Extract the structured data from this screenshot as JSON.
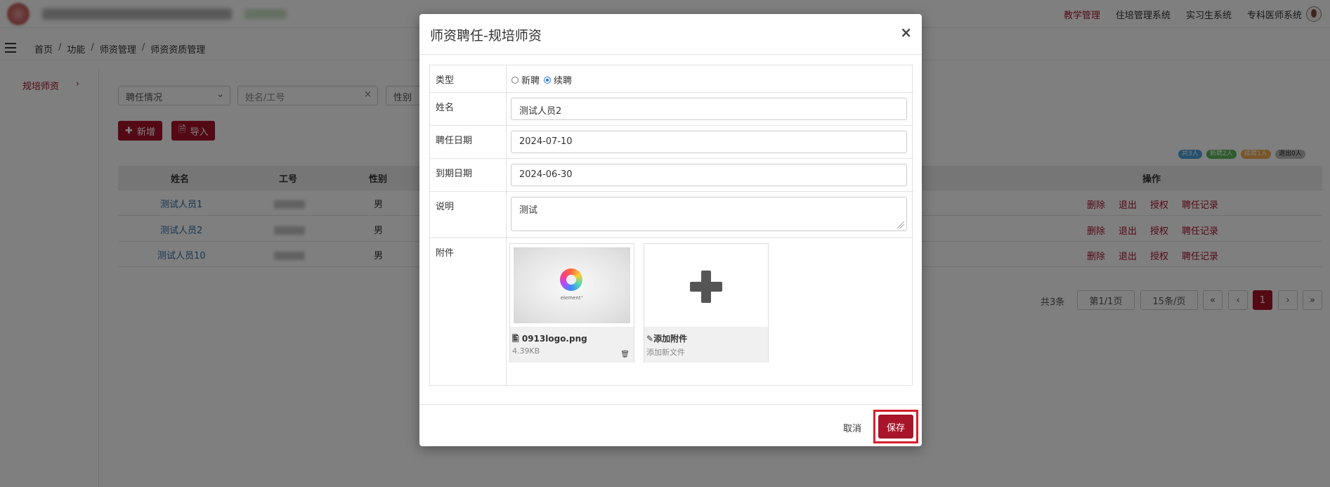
{
  "topbar": {
    "nav": [
      "教学管理",
      "住培管理系统",
      "实习生系统",
      "专科医师系统"
    ],
    "active_nav": "教学管理"
  },
  "breadcrumb": [
    "首页",
    "功能",
    "师资管理",
    "师资资质管理"
  ],
  "sidebar": {
    "item": "规培师资"
  },
  "filters": {
    "hire_status": "聘任情况",
    "name_placeholder": "姓名/工号",
    "clear": "×",
    "gender": "性别"
  },
  "toolbar": {
    "add": "新增",
    "import": "导入"
  },
  "stats": {
    "total": "共3人",
    "new": "新聘2人",
    "renew": "续聘1人",
    "exit": "退出0人"
  },
  "table": {
    "headers": {
      "name": "姓名",
      "id": "工号",
      "gender": "性别",
      "ops": "操作"
    },
    "rows": [
      {
        "name": "测试人员1",
        "gender": "男"
      },
      {
        "name": "测试人员2",
        "gender": "男"
      },
      {
        "name": "测试人员10",
        "gender": "男"
      }
    ],
    "ops": {
      "delete": "删除",
      "exit": "退出",
      "grant": "授权",
      "history": "聘任记录"
    }
  },
  "pagination": {
    "total": "共3条",
    "page": "第1/1页",
    "per": "15条/页",
    "first": "«",
    "prev": "‹",
    "current": "1",
    "next": "›",
    "last": "»"
  },
  "modal": {
    "title": "师资聘任-规培师资",
    "close": "×",
    "fields": {
      "type_label": "类型",
      "type_options": [
        "新聘",
        "续聘"
      ],
      "type_selected": "续聘",
      "name_label": "姓名",
      "name_value": "测试人员2",
      "hire_label": "聘任日期",
      "hire_value": "2024-07-10",
      "expire_label": "到期日期",
      "expire_value": "2024-06-30",
      "desc_label": "说明",
      "desc_value": "测试",
      "attach_label": "附件"
    },
    "attachment": {
      "logo_text": "element⁺",
      "name": "0913logo.png",
      "size": "4.39KB"
    },
    "add_attachment": {
      "title": "添加附件",
      "sub": "添加新文件"
    },
    "cancel": "取消",
    "save": "保存"
  }
}
